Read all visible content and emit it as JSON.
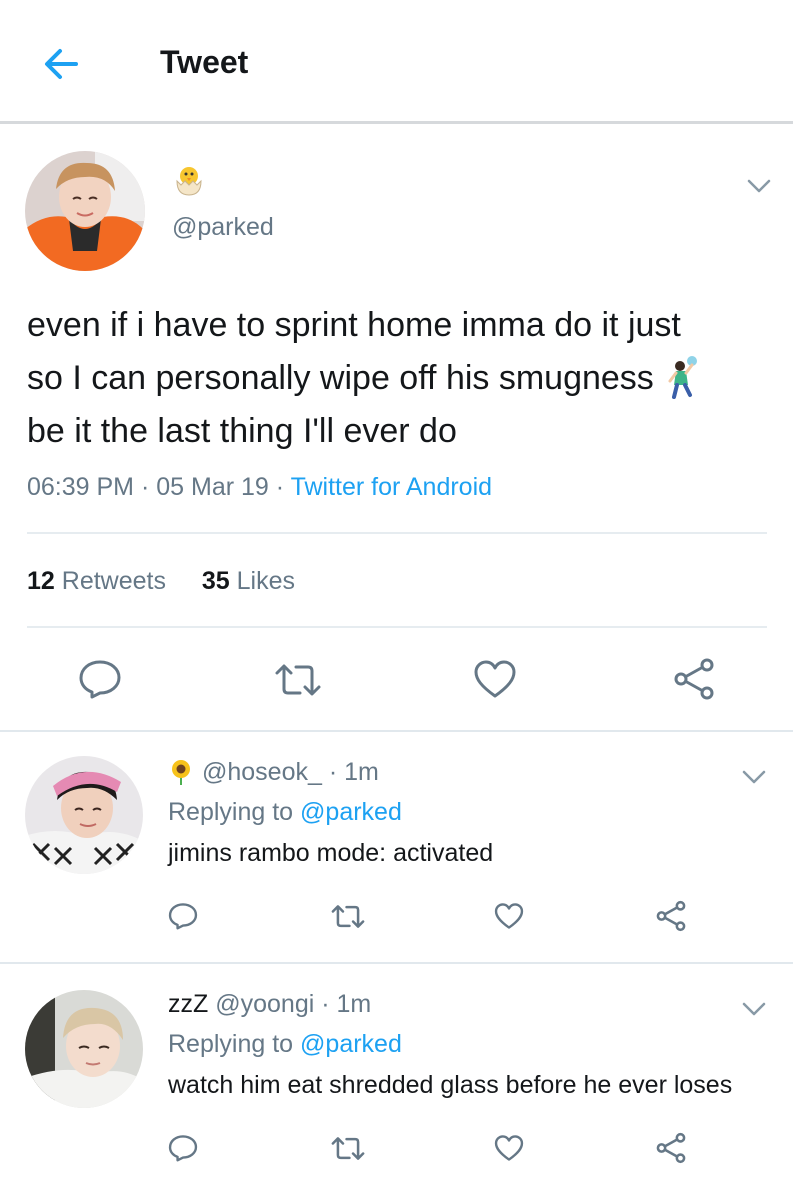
{
  "header": {
    "title": "Tweet"
  },
  "main_tweet": {
    "display_name_icon": "hatching-chick-emoji",
    "handle": "@parked",
    "text_line1": "even if i have to sprint home imma do it just",
    "text_line2": "so I can personally wipe off his smugness",
    "text_line2_icon": "person-playing-handball-emoji",
    "text_line3": "be it the last thing I'll ever do",
    "time": "06:39 PM",
    "sep1": " · ",
    "date": "05 Mar 19",
    "sep2": " · ",
    "source": "Twitter for Android",
    "retweets_count": "12",
    "retweets_label": "Retweets",
    "likes_count": "35",
    "likes_label": "Likes"
  },
  "replies": [
    {
      "display_name_icon": "sunflower-emoji",
      "name": "",
      "handle": "@hoseok_",
      "sep": " · ",
      "time": "1m",
      "replying_prefix": "Replying to ",
      "replying_to": "@parked",
      "text": "jimins rambo mode: activated"
    },
    {
      "display_name_icon": "",
      "name": "zzZ",
      "handle": "@yoongi",
      "sep": " · ",
      "time": "1m",
      "replying_prefix": "Replying to ",
      "replying_to": "@parked",
      "text": "watch him eat shredded glass before he ever loses"
    }
  ],
  "colors": {
    "accent": "#1da1f2",
    "secondary_text": "#657786",
    "primary_text": "#14171a",
    "divider": "#e6ecf0"
  }
}
